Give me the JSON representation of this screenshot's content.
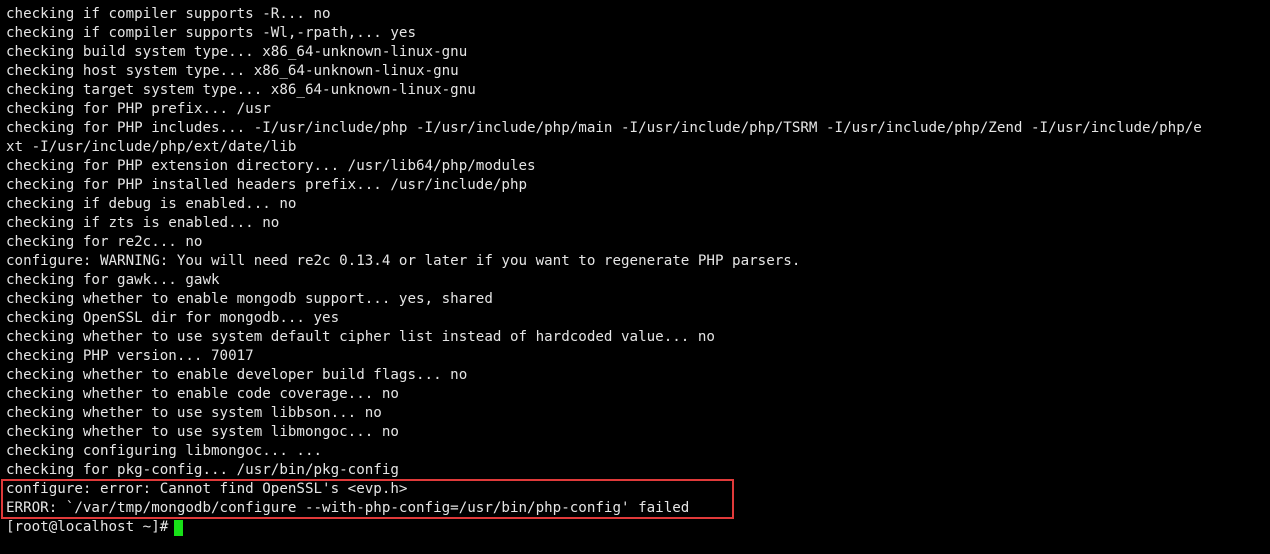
{
  "terminal": {
    "lines": [
      "checking if compiler supports -R... no",
      "checking if compiler supports -Wl,-rpath,... yes",
      "checking build system type... x86_64-unknown-linux-gnu",
      "checking host system type... x86_64-unknown-linux-gnu",
      "checking target system type... x86_64-unknown-linux-gnu",
      "checking for PHP prefix... /usr",
      "checking for PHP includes... -I/usr/include/php -I/usr/include/php/main -I/usr/include/php/TSRM -I/usr/include/php/Zend -I/usr/include/php/e",
      "xt -I/usr/include/php/ext/date/lib",
      "checking for PHP extension directory... /usr/lib64/php/modules",
      "checking for PHP installed headers prefix... /usr/include/php",
      "checking if debug is enabled... no",
      "checking if zts is enabled... no",
      "checking for re2c... no",
      "configure: WARNING: You will need re2c 0.13.4 or later if you want to regenerate PHP parsers.",
      "checking for gawk... gawk",
      "checking whether to enable mongodb support... yes, shared",
      "checking OpenSSL dir for mongodb... yes",
      "checking whether to use system default cipher list instead of hardcoded value... no",
      "checking PHP version... 70017",
      "checking whether to enable developer build flags... no",
      "checking whether to enable code coverage... no",
      "checking whether to use system libbson... no",
      "checking whether to use system libmongoc... no",
      "checking configuring libmongoc... ...",
      "checking for pkg-config... /usr/bin/pkg-config"
    ],
    "error_lines": [
      "configure: error: Cannot find OpenSSL's <evp.h>",
      "ERROR: `/var/tmp/mongodb/configure --with-php-config=/usr/bin/php-config' failed"
    ],
    "prompt": "[root@localhost ~]#",
    "colors": {
      "background": "#000000",
      "text": "#e5e5e5",
      "highlight_border": "#e03a3a",
      "cursor": "#18e018"
    }
  }
}
